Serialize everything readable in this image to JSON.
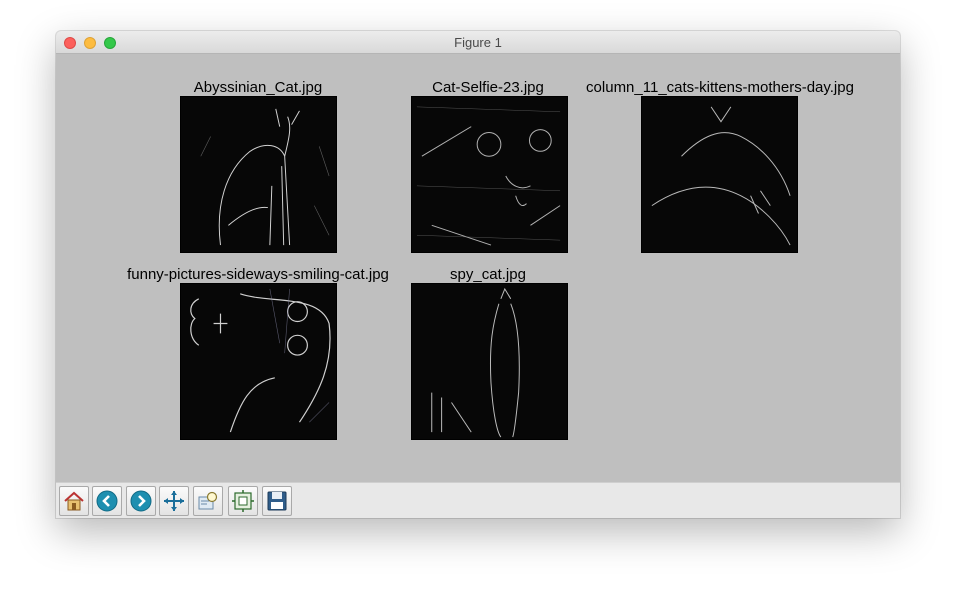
{
  "window": {
    "title": "Figure 1"
  },
  "panels": [
    {
      "title": "Abyssinian_Cat.jpg"
    },
    {
      "title": "Cat-Selfie-23.jpg"
    },
    {
      "title": "column_11_cats-kittens-mothers-day.jpg"
    },
    {
      "title": "funny-pictures-sideways-smiling-cat.jpg"
    },
    {
      "title": "spy_cat.jpg"
    }
  ],
  "toolbar": {
    "buttons": [
      {
        "icon": "home-icon"
      },
      {
        "icon": "back-arrow-icon"
      },
      {
        "icon": "forward-arrow-icon"
      },
      {
        "icon": "pan-icon"
      },
      {
        "icon": "zoom-rect-icon"
      },
      {
        "icon": "subplots-icon"
      },
      {
        "icon": "save-icon"
      }
    ]
  }
}
